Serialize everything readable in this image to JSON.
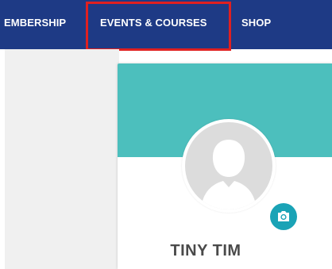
{
  "nav": {
    "membership_label": "EMBERSHIP",
    "events_label": "EVENTS & COURSES",
    "shop_label": "SHOP",
    "background_color": "#1e3a85",
    "highlight_color": "#e02020"
  },
  "profile": {
    "name": "TINY TIM",
    "banner_color": "#4cbfbd",
    "camera_button_color": "#1aa3b6",
    "avatar_icon": "user-silhouette-icon",
    "camera_icon": "camera-icon"
  }
}
